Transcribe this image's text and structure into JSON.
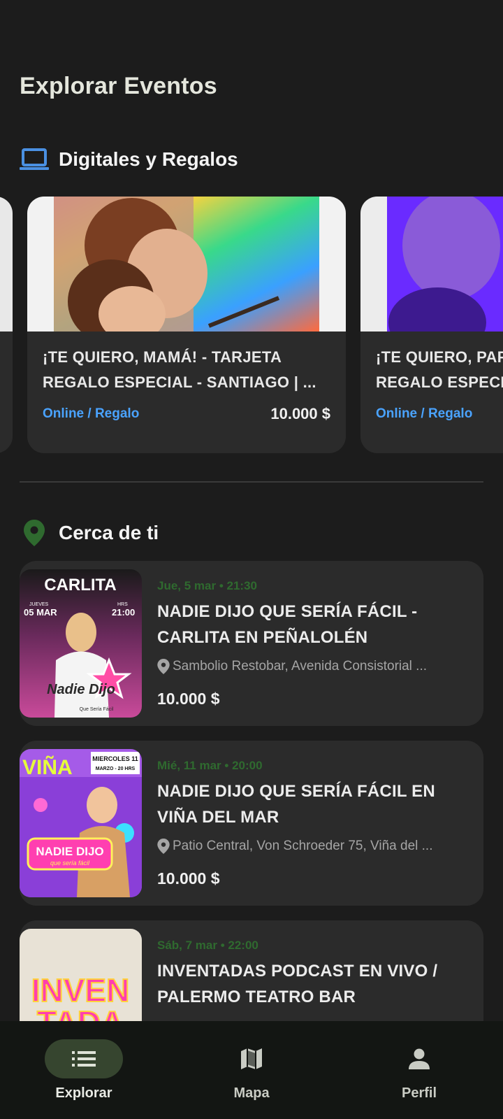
{
  "page": {
    "title": "Explorar Eventos"
  },
  "digital_section": {
    "title": "Digitales y Regalos",
    "icon": "laptop-icon",
    "accent": "#4a90e2",
    "cards": [
      {
        "title": "¡TE QUIERO, MAMÁ! - TARJETA REGALO ESPECIAL - SANTIAGO | ...",
        "type": "Online / Regalo",
        "price": "10.000 $"
      },
      {
        "title": "¡TE QUIERO, PAPÁ! - TARJETA REGALO ESPECIAL",
        "type": "Online / Regalo",
        "price": ""
      }
    ]
  },
  "nearby_section": {
    "title": "Cerca de ti",
    "icon": "location-pin-icon",
    "accent": "#2f6a2f",
    "events": [
      {
        "date": "Jue, 5 mar • 21:30",
        "title": "NADIE DIJO QUE SERÍA FÁCIL - CARLITA EN PEÑALOLÉN",
        "venue": "Sambolio Restobar, Avenida Consistorial ...",
        "price": "10.000 $",
        "poster": {
          "name": "CARLITA",
          "day_label": "JUEVES",
          "date": "05 MAR",
          "hour_label": "HRS",
          "time": "21:00",
          "show": "Nadie Dijo",
          "tagline": "Que Sería Fácil"
        }
      },
      {
        "date": "Mié, 11 mar • 20:00",
        "title": "NADIE DIJO QUE SERÍA FÁCIL EN VIÑA DEL MAR",
        "venue": "Patio Central, Von Schroeder 75, Viña del ...",
        "price": "10.000 $",
        "poster": {
          "name": "VIÑA",
          "day": "MIERCOLES 11",
          "date": "MARZO - 20 HRS",
          "show": "NADIE DIJO",
          "tagline": "que sería fácil"
        }
      },
      {
        "date": "Sáb, 7 mar • 22:00",
        "title": "INVENTADAS PODCAST EN VIVO / PALERMO TEATRO BAR",
        "venue": "",
        "price": "",
        "poster": {
          "line1": "INVEN",
          "line2": "TADA"
        }
      }
    ]
  },
  "nav": {
    "items": [
      {
        "label": "Explorar",
        "icon": "list-icon",
        "active": true
      },
      {
        "label": "Mapa",
        "icon": "map-icon",
        "active": false
      },
      {
        "label": "Perfil",
        "icon": "person-icon",
        "active": false
      }
    ]
  }
}
